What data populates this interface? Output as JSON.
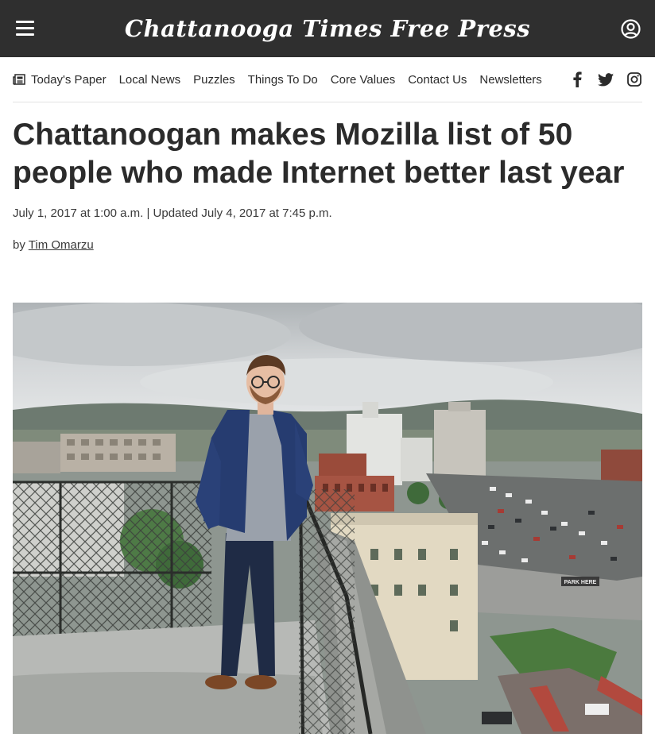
{
  "header": {
    "masthead": "Chattanooga Times Free Press",
    "menu_icon": "hamburger-menu-icon",
    "account_icon": "account-circle-icon",
    "background": "#2f2f2f"
  },
  "nav": {
    "items": [
      {
        "label": "Today's Paper",
        "icon": "newspaper-icon"
      },
      {
        "label": "Local News"
      },
      {
        "label": "Puzzles"
      },
      {
        "label": "Things To Do"
      },
      {
        "label": "Core Values"
      },
      {
        "label": "Contact Us"
      },
      {
        "label": "Newsletters"
      }
    ],
    "socials": [
      "facebook-icon",
      "twitter-icon",
      "instagram-icon"
    ]
  },
  "article": {
    "headline": "Chattanoogan makes Mozilla list of 50 people who made Internet better last year",
    "published": "July 1, 2017 at 1:00 a.m.",
    "separator": "|",
    "updated": "Updated July 4, 2017 at 7:45 p.m.",
    "by_prefix": "by",
    "author": "Tim Omarzu",
    "photo_sign": "PARK HERE"
  }
}
